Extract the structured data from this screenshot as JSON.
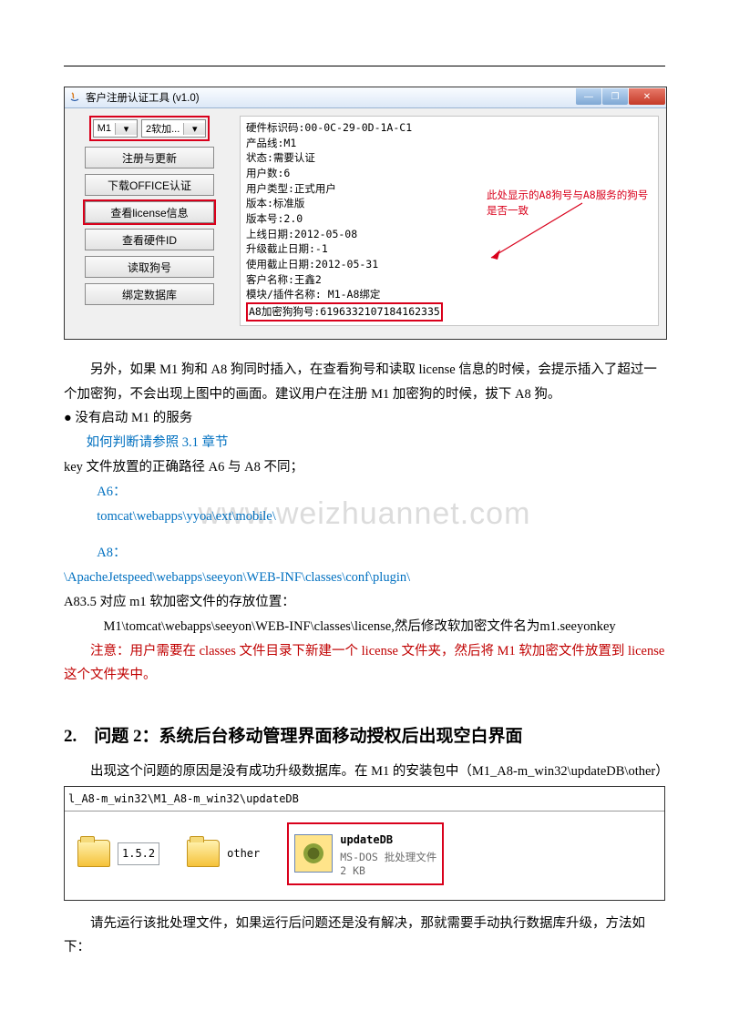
{
  "app": {
    "title": "客户注册认证工具 (v1.0)",
    "combo1": "M1",
    "combo2": "2软加...",
    "buttons": {
      "register": "注册与更新",
      "office": "下载OFFICE认证",
      "license": "查看license信息",
      "hw": "查看硬件ID",
      "dog": "读取狗号",
      "bind": "绑定数据库"
    },
    "info": {
      "l1": "硬件标识码:00-0C-29-0D-1A-C1",
      "l2": "产品线:M1",
      "l3": "状态:需要认证",
      "l4": "用户数:6",
      "l5": "用户类型:正式用户",
      "l6": "版本:标准版",
      "l7": "版本号:2.0",
      "l8": "上线日期:2012-05-08",
      "l9": "升级截止日期:-1",
      "l10": "使用截止日期:2012-05-31",
      "l11": "客户名称:王鑫2",
      "l12": "模块/插件名称: M1-A8绑定",
      "l13": "A8加密狗狗号:6196332107184162335"
    },
    "annotation": "此处显示的A8狗号与A8服务的狗号是否一致"
  },
  "body": {
    "p1": "另外，如果 M1 狗和 A8 狗同时插入，在查看狗号和读取 license 信息的时候，会提示插入了超过一个加密狗，不会出现上图中的画面。建议用户在注册 M1 加密狗的时候，拔下 A8 狗。",
    "b1": "没有启动 M1 的服务",
    "b1link": "如何判断请参照 3.1 章节",
    "p2": "key 文件放置的正确路径 A6 与 A8 不同；",
    "a6label": "A6：",
    "a6path": "tomcat\\webapps\\yyoa\\ext\\mobile\\",
    "a8label": "A8：",
    "a8path": "\\ApacheJetspeed\\webapps\\seeyon\\WEB-INF\\classes\\conf\\plugin\\",
    "p3": "A83.5 对应 m1 软加密文件的存放位置：",
    "p3path": "M1\\tomcat\\webapps\\seeyon\\WEB-INF\\classes\\license,然后修改软加密文件名为m1.seeyonkey",
    "note": "注意：用户需要在 classes 文件目录下新建一个 license 文件夹，然后将 M1 软加密文件放置到 license 这个文件夹中。"
  },
  "watermark": "www.weizhuannet.com",
  "section2": {
    "heading": "2.　问题 2：系统后台移动管理界面移动授权后出现空白界面",
    "p1": "出现这个问题的原因是没有成功升级数据库。在 M1 的安装包中（M1_A8-m_win32\\updateDB\\other）",
    "addr": "l_A8-m_win32\\M1_A8-m_win32\\updateDB",
    "files": {
      "folder1": "1.5.2",
      "folder2": "other",
      "exeName": "updateDB",
      "exeType": "MS-DOS 批处理文件",
      "exeSize": "2 KB"
    },
    "p2": "请先运行该批处理文件，如果运行后问题还是没有解决，那就需要手动执行数据库升级，方法如下："
  }
}
